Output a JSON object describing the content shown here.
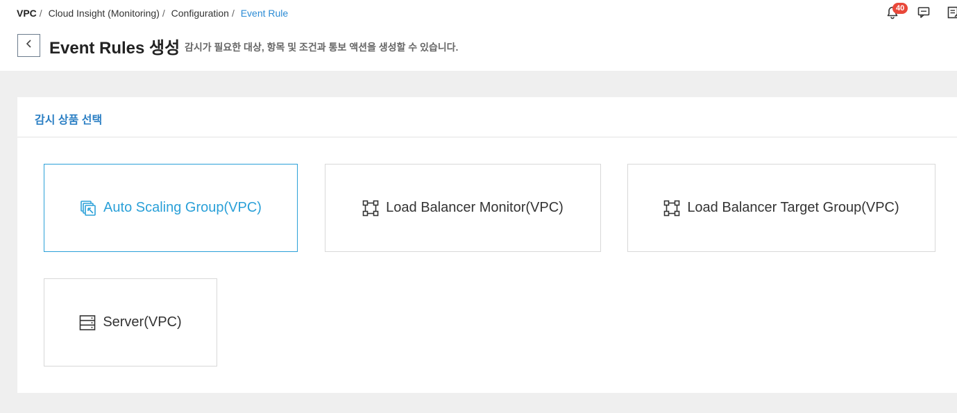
{
  "breadcrumb": {
    "items": [
      "VPC",
      "Cloud Insight (Monitoring)",
      "Configuration",
      "Event Rule"
    ],
    "separator": "/"
  },
  "header": {
    "notification_count": "40",
    "icons": [
      "bell-icon",
      "chat-icon",
      "memo-icon"
    ]
  },
  "page": {
    "title": "Event Rules 생성",
    "description": "감시가 필요한 대상, 항목 및 조건과 통보 액션을 생성할 수 있습니다.",
    "back_icon": "chevron-left-icon"
  },
  "panel": {
    "title": "감시 상품 선택",
    "products": [
      {
        "label": "Auto Scaling Group(VPC)",
        "icon": "auto-scaling-icon",
        "selected": true
      },
      {
        "label": "Load Balancer Monitor(VPC)",
        "icon": "load-balancer-icon",
        "selected": false
      },
      {
        "label": "Load Balancer Target Group(VPC)",
        "icon": "load-balancer-icon",
        "selected": false
      },
      {
        "label": "Server(VPC)",
        "icon": "server-icon",
        "selected": false
      }
    ]
  },
  "colors": {
    "accent": "#2aa0d8",
    "title_blue": "#2b7fc4",
    "badge": "#e9483a"
  }
}
